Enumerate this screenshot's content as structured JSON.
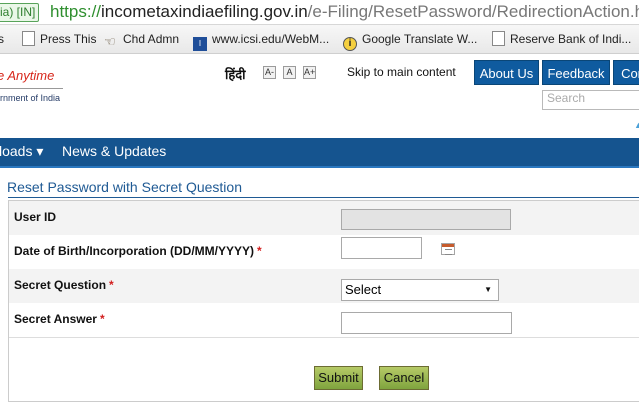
{
  "browser": {
    "secure_badge": "ia) [IN]",
    "url_scheme": "https://",
    "url_domain": "incometaxindiaefiling.gov.in",
    "url_path": "/e-Filing/ResetPassword/RedirectionAction.html"
  },
  "bookmarks": [
    "s",
    "Press This",
    "Chd Admn",
    "www.icsi.edu/WebM...",
    "Google Translate W...",
    "Reserve Bank of Indi..."
  ],
  "site": {
    "tagline": "e Anytime",
    "government_label": "ernment of India",
    "hindi_label": "हिंदी",
    "font_sizes": [
      "A-",
      "A",
      "A+"
    ],
    "skip_link": "Skip to main content",
    "top_buttons": [
      "About Us",
      "Feedback",
      "Con"
    ],
    "search_placeholder": "Search",
    "nav": {
      "downloads": "loads",
      "downloads_caret": "▾",
      "news": "News & Updates"
    }
  },
  "form": {
    "title": "Reset Password with Secret Question",
    "fields": [
      {
        "label": "User ID",
        "required": "",
        "value": ""
      },
      {
        "label": "Date of Birth/Incorporation (DD/MM/YYYY)",
        "required": "*",
        "value": ""
      },
      {
        "label": "Secret Question",
        "required": "*",
        "value": "Select"
      },
      {
        "label": "Secret Answer",
        "required": "*",
        "value": ""
      }
    ],
    "submit": "Submit",
    "cancel": "Cancel"
  },
  "colors": {
    "nav_blue": "#15548f",
    "heading_blue": "#1f5a94",
    "button_green": "#8fb14a",
    "required_red": "#d21e1e"
  }
}
